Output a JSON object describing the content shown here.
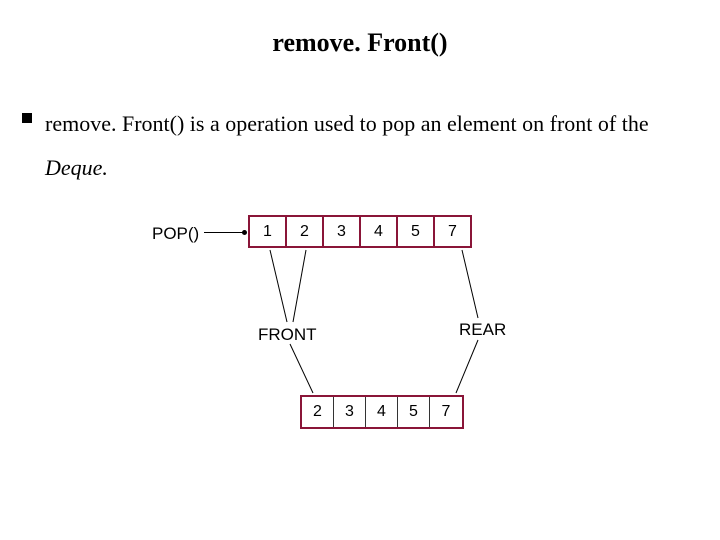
{
  "title": "remove. Front()",
  "desc_part1": "remove. Front() is a operation used to pop an element on front of the ",
  "desc_part2": "Deque.",
  "pop_label": "POP()",
  "front_label": "FRONT",
  "rear_label": "REAR",
  "colors": {
    "border": "#8a1538"
  },
  "chart_data": {
    "type": "table",
    "before": [
      "1",
      "2",
      "3",
      "4",
      "5",
      "7"
    ],
    "after": [
      "2",
      "3",
      "4",
      "5",
      "7"
    ]
  }
}
